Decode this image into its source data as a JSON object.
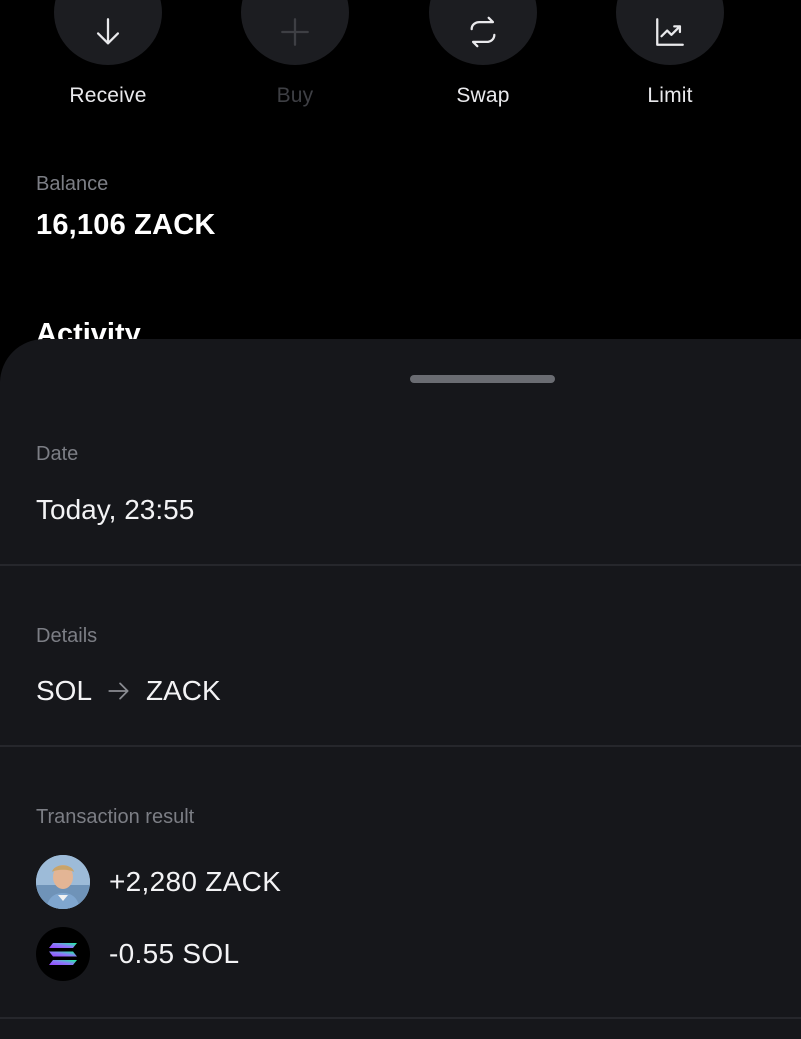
{
  "actions": [
    {
      "label": "Receive",
      "icon": "arrow-down-icon",
      "enabled": true
    },
    {
      "label": "Buy",
      "icon": "plus-icon",
      "enabled": false
    },
    {
      "label": "Swap",
      "icon": "swap-icon",
      "enabled": true
    },
    {
      "label": "Limit",
      "icon": "chart-up-icon",
      "enabled": true
    }
  ],
  "balance": {
    "label": "Balance",
    "value": "16,106 ZACK"
  },
  "activity": {
    "title": "Activity"
  },
  "sheet": {
    "date": {
      "label": "Date",
      "value": "Today, 23:55"
    },
    "details": {
      "label": "Details",
      "from": "SOL",
      "to": "ZACK",
      "arrow_icon": "arrow-right-icon"
    },
    "result": {
      "label": "Transaction result",
      "items": [
        {
          "text": "+2,280 ZACK",
          "icon": "zack-avatar"
        },
        {
          "text": "-0.55 SOL",
          "icon": "solana-logo-icon"
        }
      ]
    }
  },
  "colors": {
    "background": "#000000",
    "sheet": "#16171b",
    "muted_text": "#7c7e85",
    "disabled_text": "#3e3f44",
    "circle": "#1c1d21"
  }
}
